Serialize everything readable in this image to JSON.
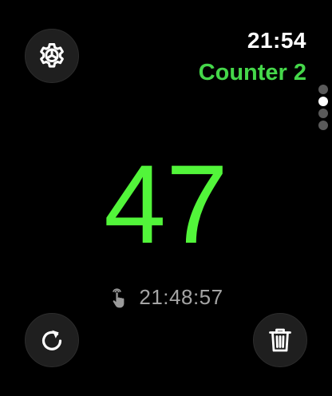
{
  "status": {
    "time": "21:54"
  },
  "counter": {
    "name": "Counter 2",
    "value": "47",
    "last_tap_time": "21:48:57",
    "accent_color": "#45d74a",
    "value_color": "#52f53a"
  },
  "pager": {
    "page_count": 4,
    "current_page": 2
  },
  "icons": {
    "settings": "gear-icon",
    "reset": "reset-arrow-icon",
    "delete": "trash-icon",
    "last_tap": "tap-hand-icon"
  }
}
